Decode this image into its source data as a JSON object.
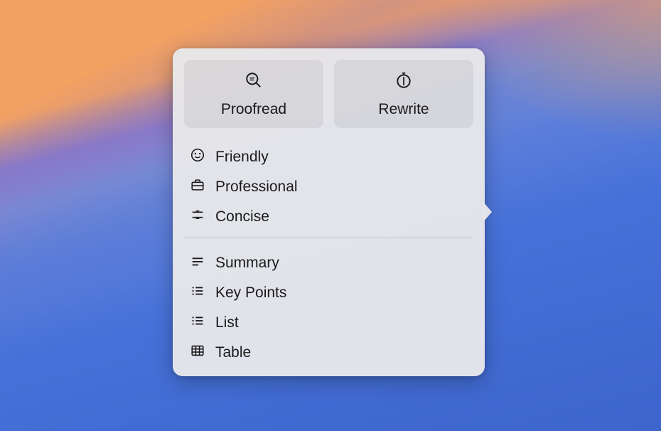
{
  "popover": {
    "topButtons": {
      "proofread": "Proofread",
      "rewrite": "Rewrite"
    },
    "toneSection": {
      "friendly": "Friendly",
      "professional": "Professional",
      "concise": "Concise"
    },
    "formatSection": {
      "summary": "Summary",
      "keyPoints": "Key Points",
      "list": "List",
      "table": "Table"
    }
  }
}
